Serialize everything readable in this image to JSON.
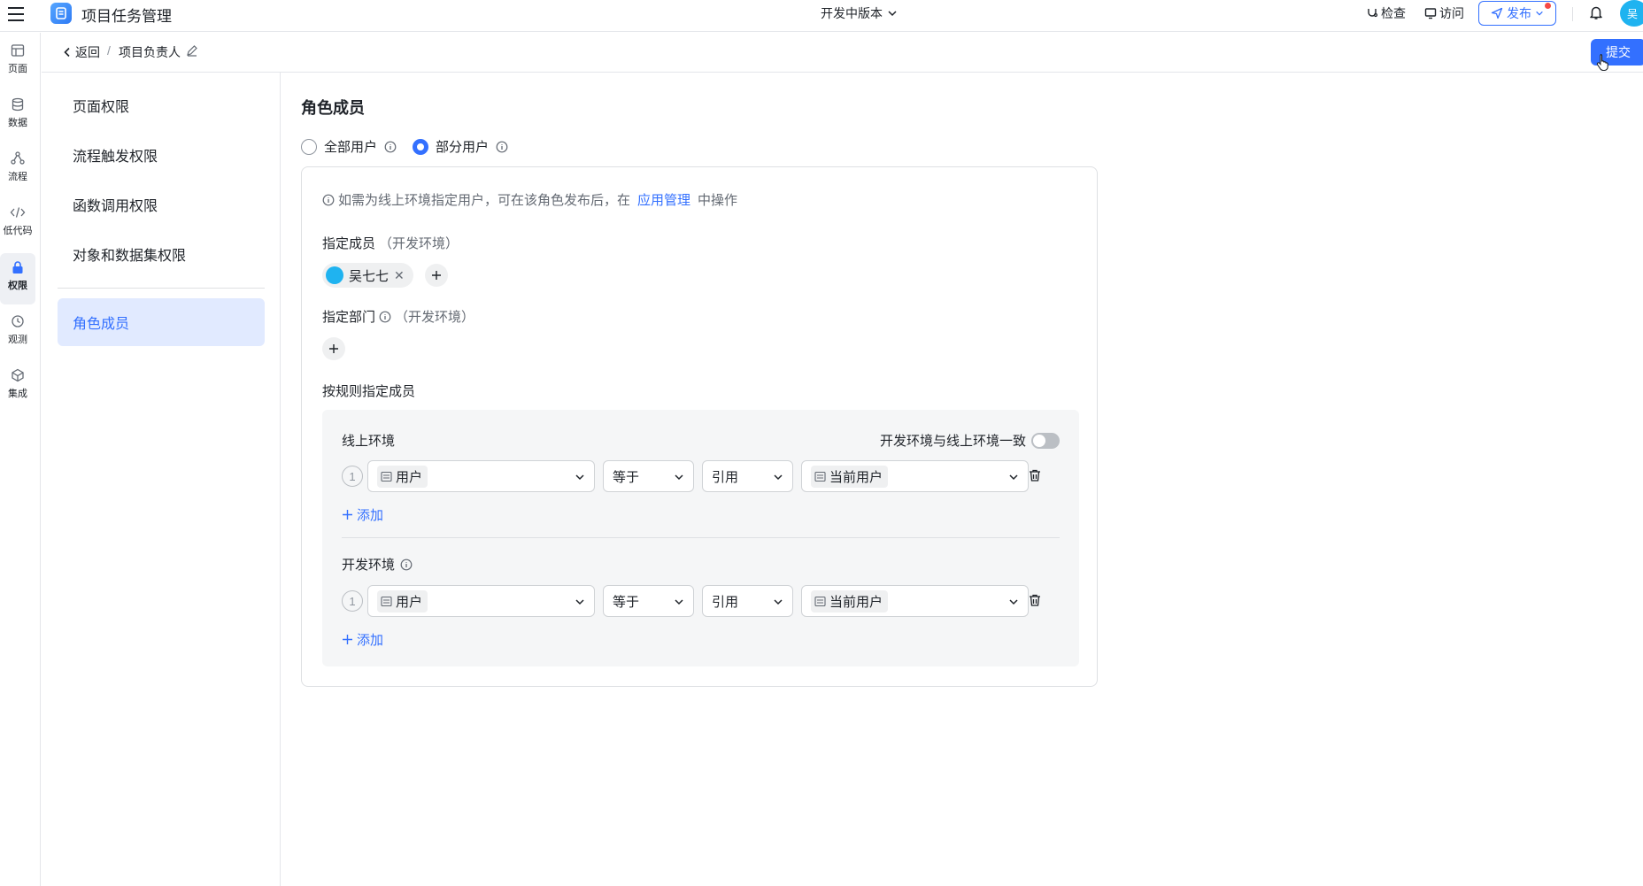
{
  "topbar": {
    "app_title": "项目任务管理",
    "version_label": "开发中版本",
    "check_label": "检查",
    "visit_label": "访问",
    "publish_label": "发布",
    "avatar_initial": "吴"
  },
  "rail": {
    "items": [
      {
        "label": "页面",
        "icon": "page-icon"
      },
      {
        "label": "数据",
        "icon": "database-icon"
      },
      {
        "label": "流程",
        "icon": "flow-icon"
      },
      {
        "label": "低代码",
        "icon": "code-icon"
      },
      {
        "label": "权限",
        "icon": "lock-icon"
      },
      {
        "label": "观测",
        "icon": "observe-icon"
      },
      {
        "label": "集成",
        "icon": "integration-icon"
      }
    ]
  },
  "subheader": {
    "back_label": "返回",
    "separator": "/",
    "role_title": "项目负责人",
    "submit_label": "提交"
  },
  "menu": {
    "items": [
      {
        "label": "页面权限"
      },
      {
        "label": "流程触发权限"
      },
      {
        "label": "函数调用权限"
      },
      {
        "label": "对象和数据集权限"
      }
    ],
    "active_item": "角色成员"
  },
  "main": {
    "section_title": "角色成员",
    "radio_all": "全部用户",
    "radio_partial": "部分用户",
    "tip_prefix": "如需为线上环境指定用户，可在该角色发布后，在",
    "tip_link": "应用管理",
    "tip_suffix": "中操作",
    "members_label": "指定成员",
    "members_env": "（开发环境）",
    "member_tag": "吴七七",
    "dept_label": "指定部门",
    "dept_env": "（开发环境）",
    "rules_label": "按规则指定成员",
    "online": {
      "label": "线上环境",
      "sync_label": "开发环境与线上环境一致",
      "rule": {
        "index": "1",
        "field": "用户",
        "operator": "等于",
        "type": "引用",
        "value": "当前用户"
      },
      "add_label": "添加"
    },
    "dev": {
      "label": "开发环境",
      "rule": {
        "index": "1",
        "field": "用户",
        "operator": "等于",
        "type": "引用",
        "value": "当前用户"
      },
      "add_label": "添加"
    }
  },
  "colors": {
    "primary": "#3370ff",
    "active_bg": "#e1eaff",
    "border": "#dee0e3"
  }
}
